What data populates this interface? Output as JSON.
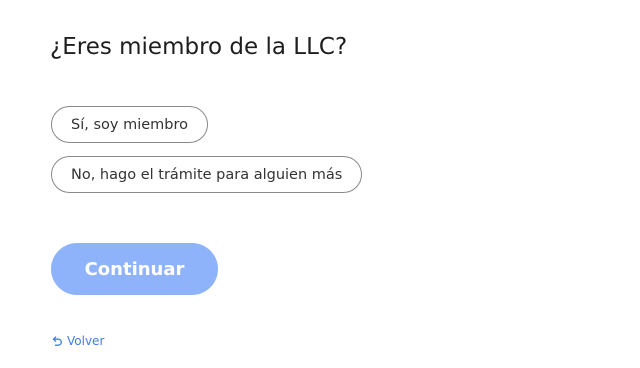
{
  "question": {
    "title": "¿Eres miembro de la LLC?"
  },
  "options": [
    {
      "label": "Sí, soy miembro"
    },
    {
      "label": "No, hago el trámite para alguien más"
    }
  ],
  "actions": {
    "continue_label": "Continuar",
    "back_label": "Volver",
    "back_icon": "undo-arrow-icon"
  },
  "colors": {
    "primary_disabled": "#8fb3fb",
    "link": "#3f7ee8",
    "pill_border": "#8a8a8a",
    "text": "#1e1e1e"
  }
}
